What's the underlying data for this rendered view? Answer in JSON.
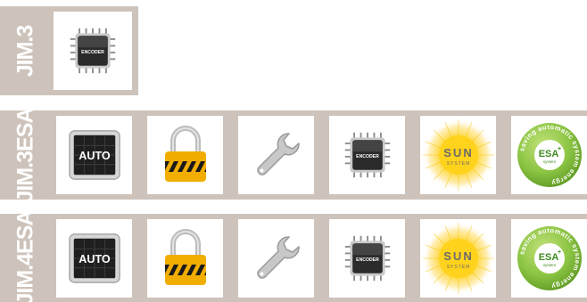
{
  "rows": [
    {
      "label": "JIM.3",
      "features": [
        {
          "icon": "encoder-chip-icon",
          "text": "ENCODER"
        }
      ]
    },
    {
      "label": "JIM.3ESA",
      "features": [
        {
          "icon": "auto-monitor-icon",
          "text": "AUTO"
        },
        {
          "icon": "padlock-icon"
        },
        {
          "icon": "wrench-icon"
        },
        {
          "icon": "encoder-chip-icon",
          "text": "ENCODER"
        },
        {
          "icon": "sun-system-icon",
          "text": "SUN",
          "subtext": "SYSTEM"
        },
        {
          "icon": "esa-badge-icon",
          "text": "ESA",
          "sup": "+",
          "subtext": "system",
          "ring": "saving automatic system energy"
        }
      ]
    },
    {
      "label": "JIM.4ESA",
      "features": [
        {
          "icon": "auto-monitor-icon",
          "text": "AUTO"
        },
        {
          "icon": "padlock-icon"
        },
        {
          "icon": "wrench-icon"
        },
        {
          "icon": "encoder-chip-icon",
          "text": "ENCODER"
        },
        {
          "icon": "sun-system-icon",
          "text": "SUN",
          "subtext": "SYSTEM"
        },
        {
          "icon": "esa-badge-icon",
          "text": "ESA",
          "sup": "+",
          "subtext": "system",
          "ring": "saving automatic system energy"
        }
      ]
    }
  ],
  "colors": {
    "band": "#cdc3bb",
    "tile": "#ffffff",
    "label_text": "#ffffff",
    "lock_body": "#f1ad00",
    "esa_green": "#8bc443",
    "sun_yellow": "#ffd21c"
  }
}
